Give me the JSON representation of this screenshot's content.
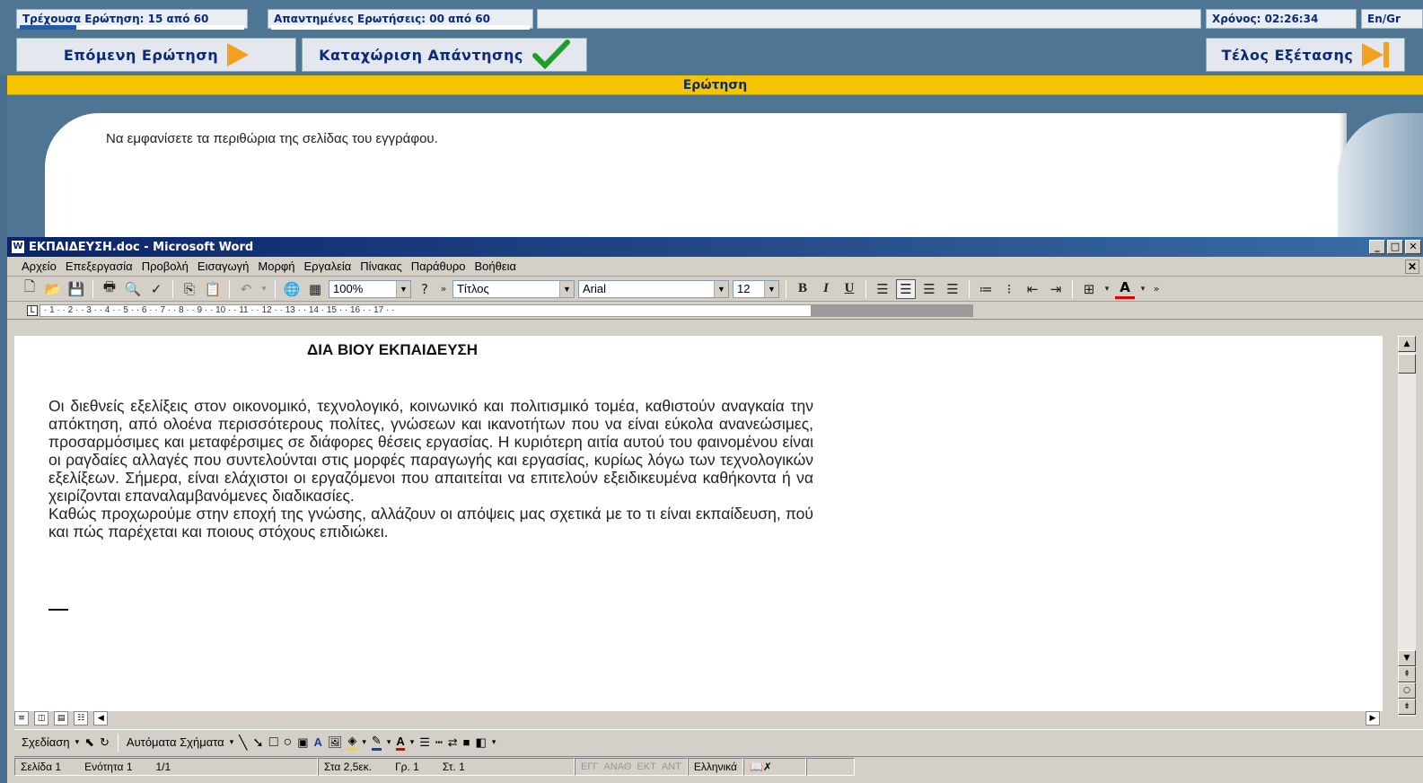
{
  "exam": {
    "current_question": "Τρέχουσα Ερώτηση: 15 από 60",
    "answered_questions": "Απαντημένες Ερωτήσεις: 00 από 60",
    "current_progress": 0.25,
    "answered_progress": 0.0,
    "timer": "Χρόνος: 02:26:34",
    "language_toggle": "En/Gr",
    "next_button": "Επόμενη Ερώτηση",
    "submit_button": "Καταχώριση Απάντησης",
    "end_button": "Τέλος Εξέτασης",
    "question_header": "Ερώτηση",
    "question_text": "Να εμφανίσετε τα περιθώρια της σελίδας του εγγράφου."
  },
  "word": {
    "title": "ΕΚΠΑΙΔΕΥΣΗ.doc - Microsoft Word",
    "menu": [
      "Αρχείο",
      "Επεξεργασία",
      "Προβολή",
      "Εισαγωγή",
      "Μορφή",
      "Εργαλεία",
      "Πίνακας",
      "Παράθυρο",
      "Βοήθεια"
    ],
    "toolbar": {
      "zoom": "100%",
      "style": "Τίτλος",
      "font": "Arial",
      "size": "12",
      "bold": "B",
      "italic": "I",
      "underline": "U"
    },
    "ruler_text": "· 1 · · 2 · · 3 · · 4 · · 5 · · 6 · · 7 · · 8 · · 9 · · 10 · · 11 · · 12 · · 13 · · 14 ·   15 · · 16 · · 17 · ·",
    "document": {
      "title": "ΔΙΑ ΒΙΟΥ ΕΚΠΑΙΔΕΥΣΗ",
      "paragraph1": "Οι διεθνείς εξελίξεις στον οικονομικό, τεχνολογικό, κοινωνικό και πολιτισμικό τομέα, καθιστούν αναγκαία την απόκτηση, από ολοένα περισσότερους πολίτες, γνώσεων και ικανοτήτων που να είναι εύκολα ανανεώσιμες, προσαρμόσιμες και μεταφέρσιμες σε διάφορες θέσεις εργασίας. Η κυριότερη αιτία αυτού του φαινομένου είναι οι ραγδαίες αλλαγές που συντελούνται στις μορφές παραγωγής και εργασίας, κυρίως λόγω των τεχνολογικών εξελίξεων. Σήμερα, είναι ελάχιστοι οι εργαζόμενοι που απαιτείται να επιτελούν εξειδικευμένα καθήκοντα ή να χειρίζονται επαναλαμβανόμενες διαδικασίες.",
      "paragraph2": "Καθώς προχωρούμε στην εποχή της γνώσης, αλλάζουν οι απόψεις μας σχετικά με το τι είναι εκπαίδευση, πού και πώς παρέχεται και ποιους στόχους επιδιώκει."
    },
    "drawbar": {
      "draw": "Σχεδίαση",
      "autoshapes": "Αυτόματα Σχήματα"
    },
    "status": {
      "page": "Σελίδα 1",
      "section": "Ενότητα 1",
      "pages": "1/1",
      "position": "Στα 2,5εκ.",
      "line": "Γρ. 1",
      "column": "Στ. 1",
      "rec": "ΕΓΓ",
      "trk": "ΑΝΑΘ",
      "ext": "ΕΚΤ",
      "ovr": "ΑΝΤ",
      "language": "Ελληνικά"
    }
  }
}
